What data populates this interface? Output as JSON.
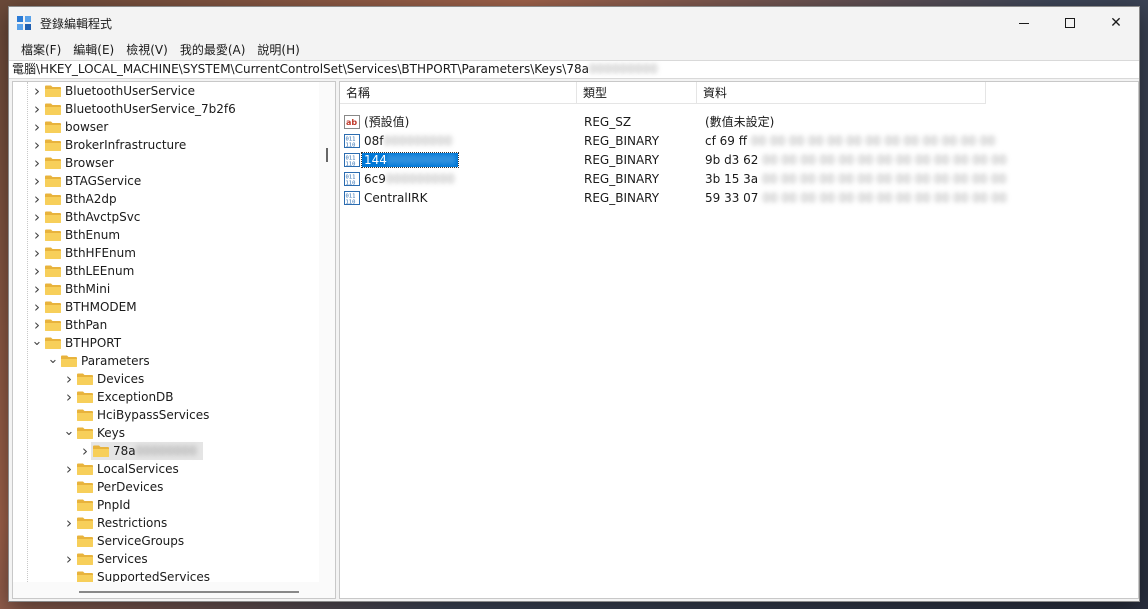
{
  "window": {
    "title": "登錄編輯程式",
    "icon": "registry-editor-icon"
  },
  "menu": [
    "檔案(F)",
    "編輯(E)",
    "檢視(V)",
    "我的最愛(A)",
    "說明(H)"
  ],
  "address": {
    "path": "電腦\\HKEY_LOCAL_MACHINE\\SYSTEM\\CurrentControlSet\\Services\\BTHPORT\\Parameters\\Keys\\78a",
    "path_redacted": "000000000"
  },
  "tree": [
    {
      "label": "BluetoothUserService",
      "level": 0,
      "expander": "collapsed"
    },
    {
      "label": "BluetoothUserService_7b2f6",
      "level": 0,
      "expander": "collapsed"
    },
    {
      "label": "bowser",
      "level": 0,
      "expander": "collapsed"
    },
    {
      "label": "BrokerInfrastructure",
      "level": 0,
      "expander": "collapsed"
    },
    {
      "label": "Browser",
      "level": 0,
      "expander": "collapsed"
    },
    {
      "label": "BTAGService",
      "level": 0,
      "expander": "collapsed"
    },
    {
      "label": "BthA2dp",
      "level": 0,
      "expander": "collapsed"
    },
    {
      "label": "BthAvctpSvc",
      "level": 0,
      "expander": "collapsed"
    },
    {
      "label": "BthEnum",
      "level": 0,
      "expander": "collapsed"
    },
    {
      "label": "BthHFEnum",
      "level": 0,
      "expander": "collapsed"
    },
    {
      "label": "BthLEEnum",
      "level": 0,
      "expander": "collapsed"
    },
    {
      "label": "BthMini",
      "level": 0,
      "expander": "collapsed"
    },
    {
      "label": "BTHMODEM",
      "level": 0,
      "expander": "collapsed"
    },
    {
      "label": "BthPan",
      "level": 0,
      "expander": "collapsed"
    },
    {
      "label": "BTHPORT",
      "level": 0,
      "expander": "expanded"
    },
    {
      "label": "Parameters",
      "level": 1,
      "expander": "expanded"
    },
    {
      "label": "Devices",
      "level": 2,
      "expander": "collapsed"
    },
    {
      "label": "ExceptionDB",
      "level": 2,
      "expander": "collapsed"
    },
    {
      "label": "HciBypassServices",
      "level": 2,
      "expander": "none"
    },
    {
      "label": "Keys",
      "level": 2,
      "expander": "expanded"
    },
    {
      "label": "78a",
      "label_redacted": "00000000",
      "level": 3,
      "expander": "collapsed",
      "selected": true
    },
    {
      "label": "LocalServices",
      "level": 2,
      "expander": "collapsed"
    },
    {
      "label": "PerDevices",
      "level": 2,
      "expander": "none"
    },
    {
      "label": "PnpId",
      "level": 2,
      "expander": "none"
    },
    {
      "label": "Restrictions",
      "level": 2,
      "expander": "collapsed"
    },
    {
      "label": "ServiceGroups",
      "level": 2,
      "expander": "none"
    },
    {
      "label": "Services",
      "level": 2,
      "expander": "collapsed"
    },
    {
      "label": "SupportedServices",
      "level": 2,
      "expander": "none"
    }
  ],
  "columns": {
    "name": "名稱",
    "type": "類型",
    "data": "資料"
  },
  "values": [
    {
      "icon": "string-value-icon",
      "name": "(預設值)",
      "name_redacted": "",
      "type": "REG_SZ",
      "data": "(數值未設定)",
      "data_redacted": ""
    },
    {
      "icon": "binary-value-icon",
      "name": "08f",
      "name_redacted": "000000000",
      "type": "REG_BINARY",
      "data": "cf 69 ff",
      "data_redacted": "00 00 00 00 00 00 00 00 00 00 00 00 00"
    },
    {
      "icon": "binary-value-icon",
      "name": "144",
      "name_redacted": "000000000",
      "type": "REG_BINARY",
      "data": "9b d3 62",
      "data_redacted": "00 00 00 00 00 00 00 00 00 00 00 00 00",
      "selected": true
    },
    {
      "icon": "binary-value-icon",
      "name": "6c9",
      "name_redacted": "000000000",
      "type": "REG_BINARY",
      "data": "3b 15 3a",
      "data_redacted": "00 00 00 00 00 00 00 00 00 00 00 00 00"
    },
    {
      "icon": "binary-value-icon",
      "name": "CentralIRK",
      "name_redacted": "",
      "type": "REG_BINARY",
      "data": "59 33 07",
      "data_redacted": "00 00 00 00 00 00 00 00 00 00 00 00 00"
    }
  ],
  "colors": {
    "selection": "#0078d7",
    "folder": "#f4c04a",
    "window_bg": "#f3f3f3"
  }
}
